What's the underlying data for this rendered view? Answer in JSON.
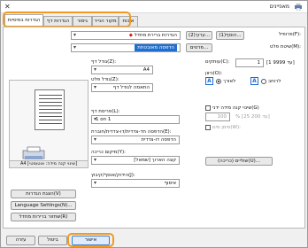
{
  "window": {
    "title": "מאפיינים"
  },
  "tabs": [
    {
      "label": "הגדרות בסיסיות",
      "active": true
    },
    {
      "label": "הגדרות דף"
    },
    {
      "label": "גימור"
    },
    {
      "label": "מקור הנייר"
    },
    {
      "label": "איכות"
    }
  ],
  "profile": {
    "label": "פרופיל(F):",
    "value": "הגדרות ברירת מחדל",
    "add_button": "הוסף(1)...",
    "edit_button": "ערוך(2)..."
  },
  "output": {
    "label": "שיטת פלט(M):",
    "value": "הדפסה מאובטחת",
    "detail_button": "פרטים..."
  },
  "page_size": {
    "label": "גודל דף(Z):",
    "value": "A4"
  },
  "output_size": {
    "label": "גודל פלט(Z):",
    "value": "התאמה לגודל דף"
  },
  "copies": {
    "label": "עותקים(C):",
    "value": "1",
    "range": "[1 עד 9999]"
  },
  "orientation": {
    "label": "כיוון(O):",
    "portrait": "לאורך",
    "landscape": "לרוחב",
    "portrait_icon": "A",
    "landscape_icon": "A"
  },
  "layout": {
    "label": "פריסת דף(L):",
    "value": "1 on 1"
  },
  "manual_scale": {
    "label": "שינוי קנה מידה ידני(G)",
    "value": "100",
    "range": "% [25 עד 200]"
  },
  "watermark": {
    "label": "סימן מים(W):"
  },
  "duplex": {
    "label": "הדפסה חד-צדדית/דו-צדדית/חוברת(E):",
    "value": "הדפסה דו-צדדית"
  },
  "binding": {
    "label": "מיקום כריכה(Y):",
    "value": "קצה הארוך [שמאל]",
    "margin_button": "שוליים (כריכה)(U)..."
  },
  "finishing": {
    "label": "הידוק/אוסף/קיבוץ(J):",
    "value": "איסוף"
  },
  "preview": {
    "caption": "A4 [שינוי קנה מידה: אוטומטי]"
  },
  "side_buttons": [
    "הצגת הגדרות(V)",
    "Language Settings(N)...",
    "שחזור ברירות מחדל(R)"
  ],
  "footer": {
    "ok": "אישור",
    "cancel": "ביטול",
    "help": "עזרה"
  },
  "colors": {
    "accent": "#f39a1e",
    "selection": "#1f6fd1"
  },
  "icons": {
    "close": "close-icon",
    "app": "printer-app-icon"
  }
}
